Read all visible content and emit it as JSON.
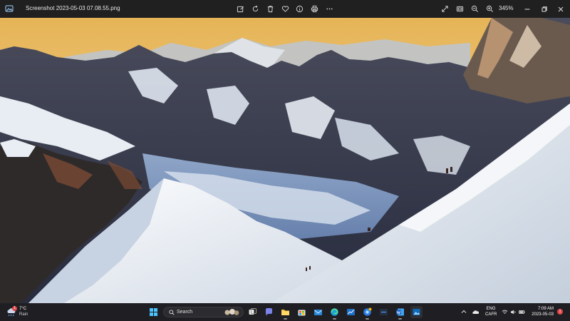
{
  "window": {
    "title": "Screenshot 2023-05-03 07.08.55.png",
    "zoom_level": "345%",
    "toolbar_icons": [
      "edit-image-icon",
      "rotate-icon",
      "delete-icon",
      "favorite-icon",
      "info-icon",
      "print-icon",
      "more-icon",
      "fullscreen-icon",
      "fit-window-icon",
      "zoom-out-icon",
      "zoom-in-icon"
    ],
    "window_controls": [
      "minimize-icon",
      "maximize-icon",
      "close-icon"
    ]
  },
  "image": {
    "subject": "alpine-mountains-with-climbers",
    "sky_color": "#e8b65a",
    "snow_color": "#eef2f6",
    "rock_color": "#3a3f52"
  },
  "taskbar": {
    "weather": {
      "temp": "7°C",
      "condition": "Rain",
      "badge": "1"
    },
    "search": {
      "placeholder": "Search"
    },
    "pinned_apps": [
      "start-icon",
      "search-icon",
      "task-view-icon",
      "chat-icon",
      "file-explorer-icon",
      "store-icon",
      "edge-icon",
      "mail-icon",
      "stocks-app-icon",
      "browser-icon",
      "dell-icon",
      "word-icon",
      "photos-icon"
    ],
    "tray": {
      "lang_line1": "ENG",
      "lang_line2": "CAFR",
      "time": "7:09 AM",
      "date": "2023-05-03",
      "notifications": "1"
    },
    "accent": "#5ab1ff"
  }
}
